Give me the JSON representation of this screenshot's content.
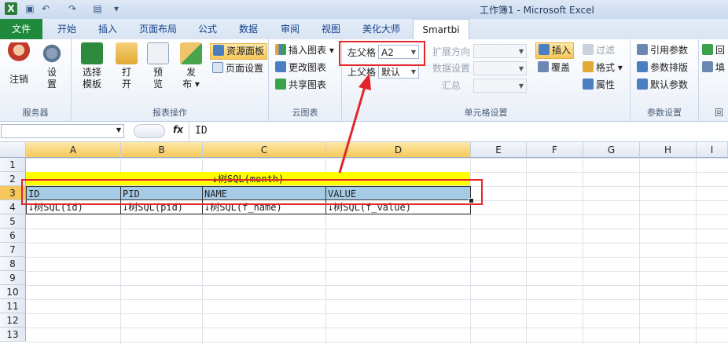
{
  "window": {
    "title": "工作簿1 - Microsoft Excel"
  },
  "tabs": [
    "文件",
    "开始",
    "插入",
    "页面布局",
    "公式",
    "数据",
    "审阅",
    "视图",
    "美化大师",
    "Smartbi"
  ],
  "ribbon": {
    "server": {
      "label": "服务器",
      "login": "注销",
      "settings_line1": "设",
      "settings_line2": "置"
    },
    "report": {
      "label": "报表操作",
      "select_line1": "选择",
      "select_line2": "模板",
      "open_line1": "打",
      "open_line2": "开",
      "preview_line1": "预",
      "preview_line2": "览",
      "publish_line1": "发",
      "publish_line2": "布 ▾",
      "resource_panel": "资源面板",
      "page_settings": "页面设置"
    },
    "cloud": {
      "label": "云图表",
      "insert_chart": "插入图表 ▾",
      "change_chart": "更改图表",
      "share_chart": "共享图表"
    },
    "cell_settings": {
      "label": "单元格设置",
      "left_parent_label": "左父格",
      "left_parent_value": "A2",
      "upper_parent_label": "上父格",
      "upper_parent_value": "默认",
      "expand_dir": "扩展方向",
      "data_settings": "数据设置",
      "summary": "汇总",
      "insert": "插入",
      "cover": "覆盖",
      "filter": "过滤",
      "format": "格式 ▾",
      "property": "属性"
    },
    "params": {
      "label": "参数设置",
      "ref_params": "引用参数",
      "param_layout": "参数排版",
      "default_params": "默认参数"
    },
    "extra": {
      "label": "回",
      "item1": "回",
      "item2": "填"
    }
  },
  "formula_bar": {
    "fx": "fx",
    "value": "ID"
  },
  "columns": [
    "A",
    "B",
    "C",
    "D",
    "E",
    "F",
    "G",
    "H",
    "I"
  ],
  "rows": [
    "1",
    "2",
    "3",
    "4",
    "5",
    "6",
    "7",
    "8",
    "9",
    "10",
    "11",
    "12",
    "13"
  ],
  "cells": {
    "c2": "↓树SQL(month)",
    "a3": "ID",
    "b3": "PID",
    "c3": "NAME",
    "d3": "VALUE",
    "a4": "↓树SQL(id)",
    "b4": "↓树SQL(pid)",
    "c4": "↓树SQL(f_name)",
    "d4": "↓树SQL(f_value)"
  },
  "colors": {
    "file_tab": "#1f8a3c",
    "highlight_yellow": "#ffff00",
    "header_blue": "#a6cbe6",
    "annotation_red": "#e2262b"
  }
}
